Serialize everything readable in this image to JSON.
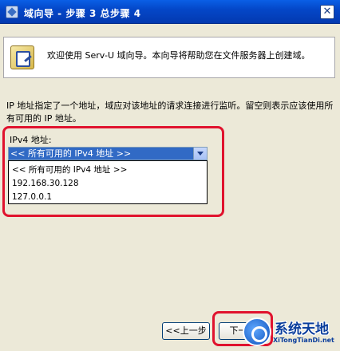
{
  "window": {
    "title": "域向导 - 步骤 3 总步骤 4"
  },
  "header": {
    "welcome": "欢迎使用 Serv-U 域向导。本向导将帮助您在文件服务器上创建域。"
  },
  "content": {
    "description": "IP 地址指定了一个地址，域应对该地址的请求连接进行监听。留空则表示应该使用所有可用的 IP 地址。",
    "ipv4_label": "IPv4 地址:",
    "ipv4_selected": "<< 所有可用的 IPv4 地址 >>",
    "ipv4_options": [
      "<< 所有可用的 IPv4 地址 >>",
      "192.168.30.128",
      "127.0.0.1"
    ]
  },
  "buttons": {
    "back": "<<上一步",
    "next": "下一步"
  },
  "watermark": {
    "title": "系统天地",
    "url": "XiTongTianDi.net"
  },
  "colors": {
    "titlebar": "#0447C8",
    "highlight": "#E0132E",
    "selection": "#316AC5"
  }
}
